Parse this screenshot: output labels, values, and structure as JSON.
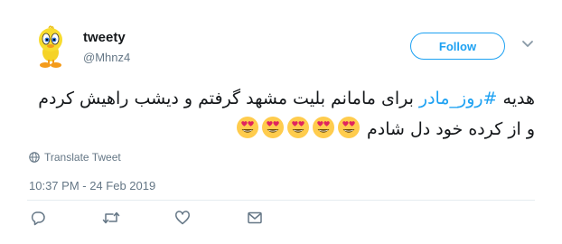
{
  "user": {
    "display_name": "tweety",
    "handle": "@Mhnz4"
  },
  "follow_label": "Follow",
  "tweet": {
    "text_before": "هدیه ",
    "hashtag": "#روز_مادر",
    "text_after": " برای مامانم بلیت مشهد گرفتم و دیشب راهیش کردم و از کرده خود دل شادم",
    "emojis": [
      "heart-eyes-emoji",
      "heart-eyes-emoji",
      "heart-eyes-emoji",
      "heart-eyes-emoji",
      "heart-eyes-emoji"
    ]
  },
  "translate_label": "Translate Tweet",
  "timestamp": "10:37 PM - 24 Feb 2019",
  "colors": {
    "accent": "#1da1f2",
    "muted": "#657786",
    "text": "#14171a"
  }
}
